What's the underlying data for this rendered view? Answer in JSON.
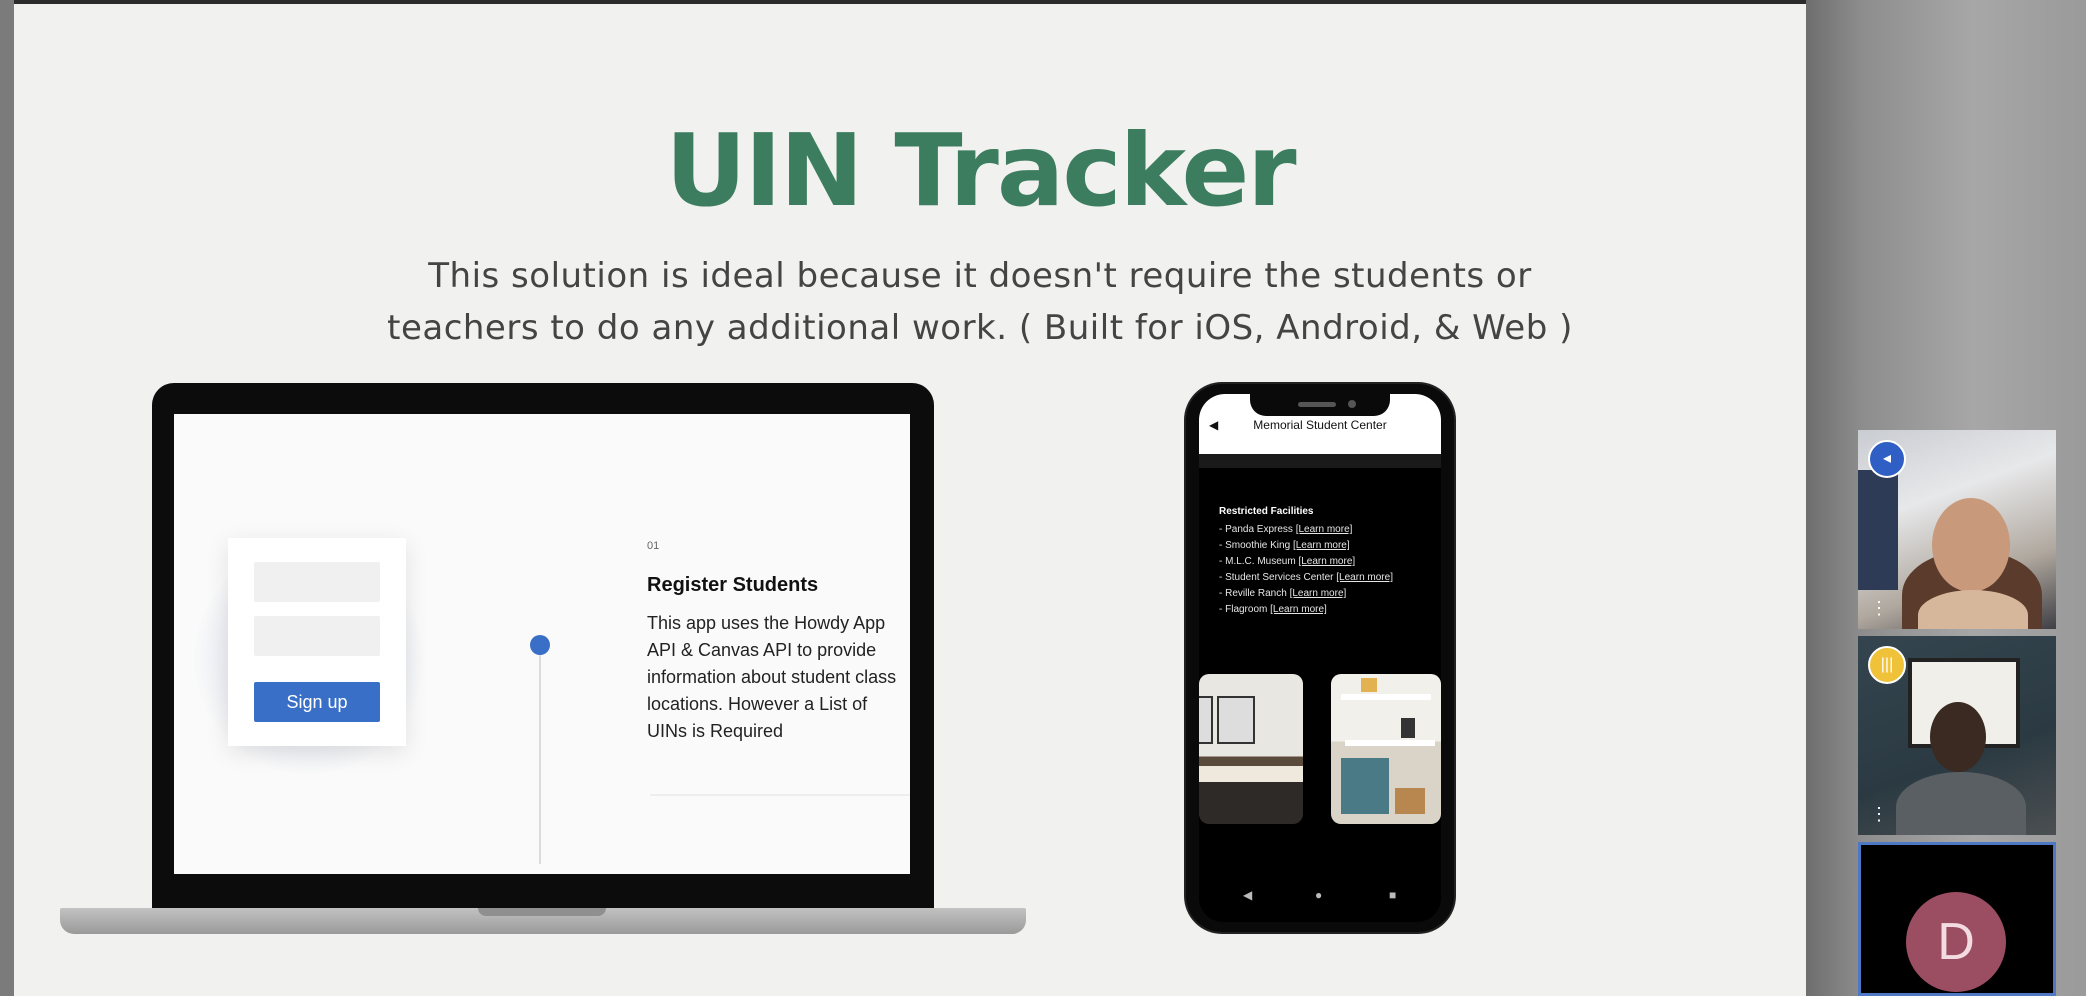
{
  "slide": {
    "title": "UIN Tracker",
    "subtitle_line1": "This solution is ideal because it doesn't require the students or",
    "subtitle_line2": "teachers to do any additional work. ( Built for iOS, Android, & Web )"
  },
  "laptop": {
    "signup_button": "Sign up",
    "step_number": "01",
    "step_title": "Register Students",
    "step_body": "This app uses the Howdy App API & Canvas API to provide information about student class locations. However a List of UINs is Required"
  },
  "phone": {
    "back_icon": "back-arrow-icon",
    "title": "Memorial Student Center",
    "facilities_heading": "Restricted Facilities",
    "facilities": [
      {
        "name": "- Panda Express ",
        "link": "[Learn more]"
      },
      {
        "name": "- Smoothie King ",
        "link": "[Learn more]"
      },
      {
        "name": "- M.L.C. Museum ",
        "link": "[Learn more]"
      },
      {
        "name": "- Student Services Center ",
        "link": "[Learn more]"
      },
      {
        "name": "- Reville Ranch ",
        "link": "[Learn more]"
      },
      {
        "name": "- Flagroom  ",
        "link": "[Learn more]"
      }
    ],
    "nav": {
      "back": "◀",
      "home": "●",
      "recent": "■"
    }
  },
  "participants": [
    {
      "badge_icon": "megaphone-icon",
      "badge_color": "#2f5fc4",
      "menu_icon": "more-vertical-icon"
    },
    {
      "badge_icon": "audio-level-icon",
      "badge_color": "#f0c23a",
      "menu_icon": "more-vertical-icon"
    },
    {
      "avatar_initial": "D",
      "avatar_color": "#9b4e62",
      "active_border": "#4f78c4"
    }
  ],
  "colors": {
    "title_green": "#3c7d5f",
    "button_blue": "#3a6fc8",
    "slide_bg": "#f1f1ef"
  }
}
